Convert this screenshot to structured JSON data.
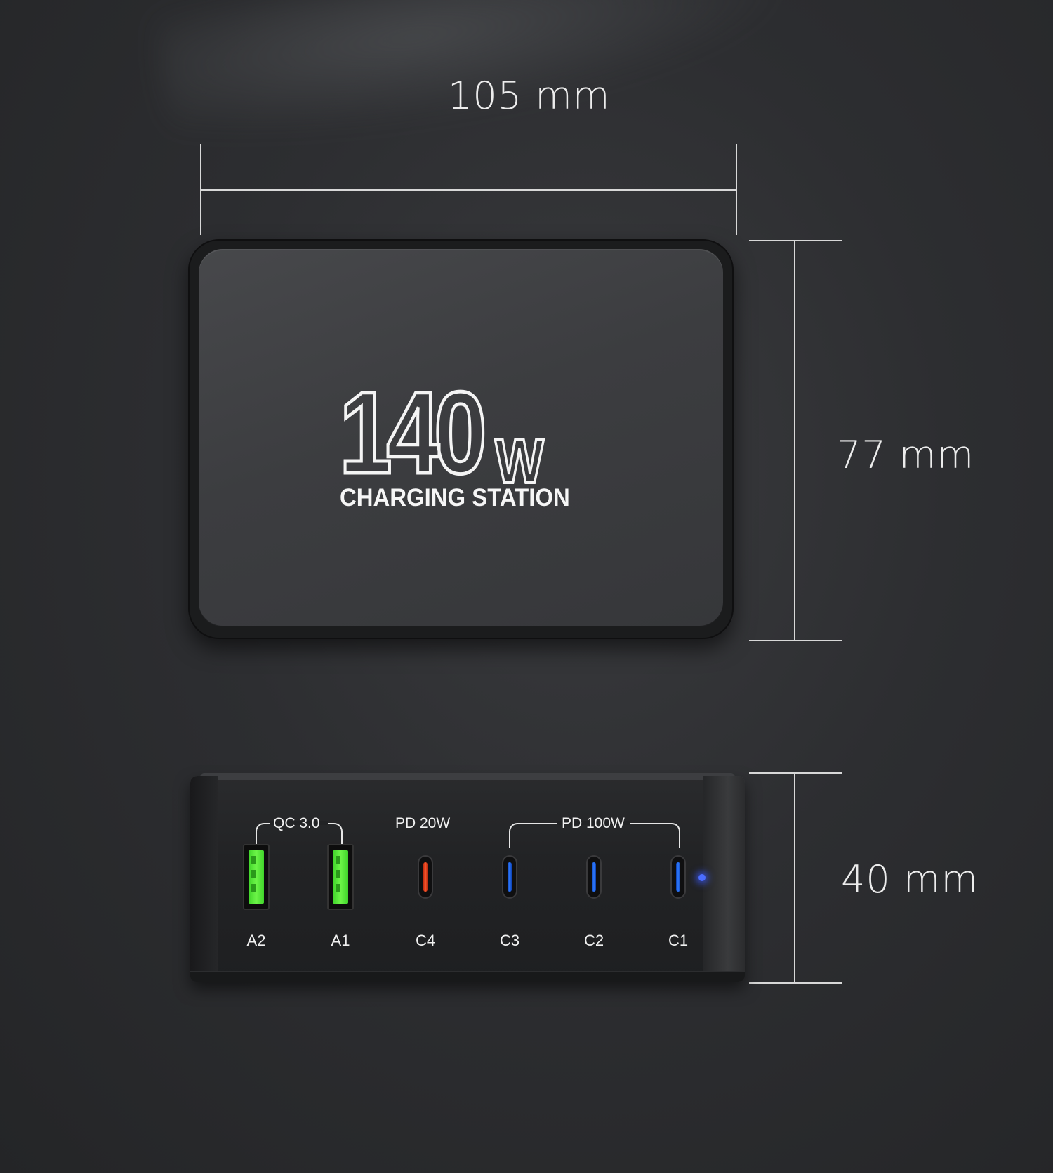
{
  "dimensions": {
    "width_label": "105 mm",
    "depth_label": "77 mm",
    "height_label": "40 mm"
  },
  "top_view": {
    "logo_number": "140",
    "logo_unit": "W",
    "logo_subtitle": "CHARGING STATION"
  },
  "front_view": {
    "groups": [
      {
        "label": "QC 3.0"
      },
      {
        "label": "PD 20W"
      },
      {
        "label": "PD 100W"
      }
    ],
    "ports": [
      {
        "label": "A2",
        "type": "usb-a",
        "color": "#56e93a"
      },
      {
        "label": "A1",
        "type": "usb-a",
        "color": "#56e93a"
      },
      {
        "label": "C4",
        "type": "usb-c",
        "color": "#ff4a22"
      },
      {
        "label": "C3",
        "type": "usb-c",
        "color": "#2f7bff"
      },
      {
        "label": "C2",
        "type": "usb-c",
        "color": "#2f7bff"
      },
      {
        "label": "C1",
        "type": "usb-c",
        "color": "#2f7bff"
      }
    ],
    "indicator_led_color": "#4b6dff"
  }
}
